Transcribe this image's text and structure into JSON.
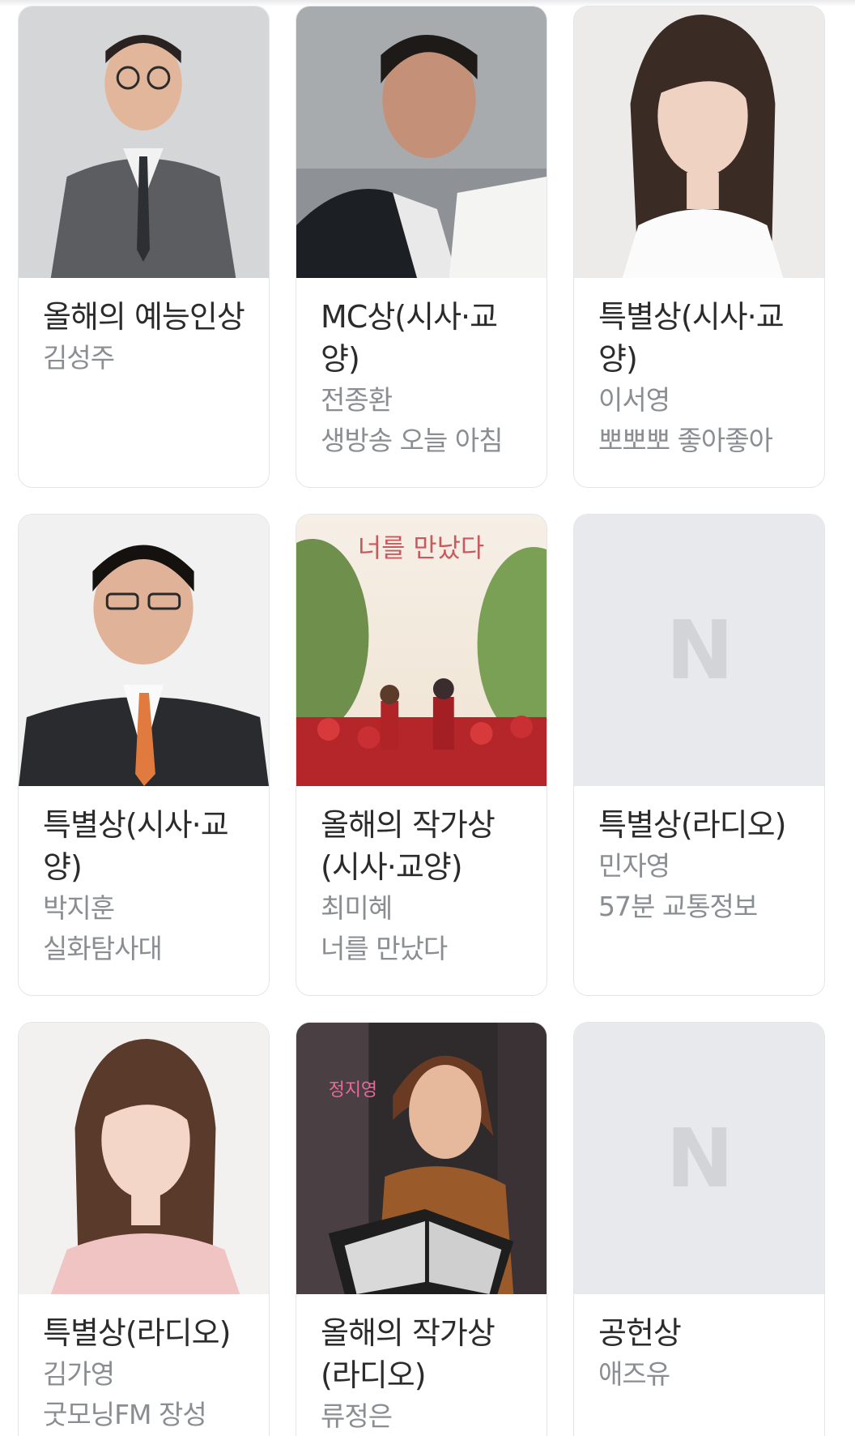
{
  "cards": [
    {
      "title": "올해의 예능인상",
      "name": "김성주",
      "program": ""
    },
    {
      "title": "MC상(시사·교양)",
      "name": "전종환",
      "program": "생방송 오늘 아침"
    },
    {
      "title": "특별상(시사·교양)",
      "name": "이서영",
      "program": "뽀뽀뽀 좋아좋아"
    },
    {
      "title": "특별상(시사·교양)",
      "name": "박지훈",
      "program": "실화탐사대"
    },
    {
      "title": "올해의 작가상(시사·교양)",
      "name": "최미혜",
      "program": "너를 만났다",
      "poster_title": "너를 만났다"
    },
    {
      "title": "특별상(라디오)",
      "name": "민자영",
      "program": "57분 교통정보",
      "placeholder_logo": "N"
    },
    {
      "title": "특별상(라디오)",
      "name": "김가영",
      "program": "굿모닝FM 장성"
    },
    {
      "title": "올해의 작가상(라디오)",
      "name": "류정은",
      "program": "",
      "poster_title": "정지영"
    },
    {
      "title": "공헌상",
      "name": "애즈유",
      "program": "",
      "placeholder_logo": "N"
    }
  ],
  "colors": {
    "title_text": "#2b2b2b",
    "sub_text": "#8a8d91",
    "card_border": "#e3e5e8",
    "placeholder_bg": "#e8e9ec",
    "placeholder_logo": "#d2d4d8"
  }
}
